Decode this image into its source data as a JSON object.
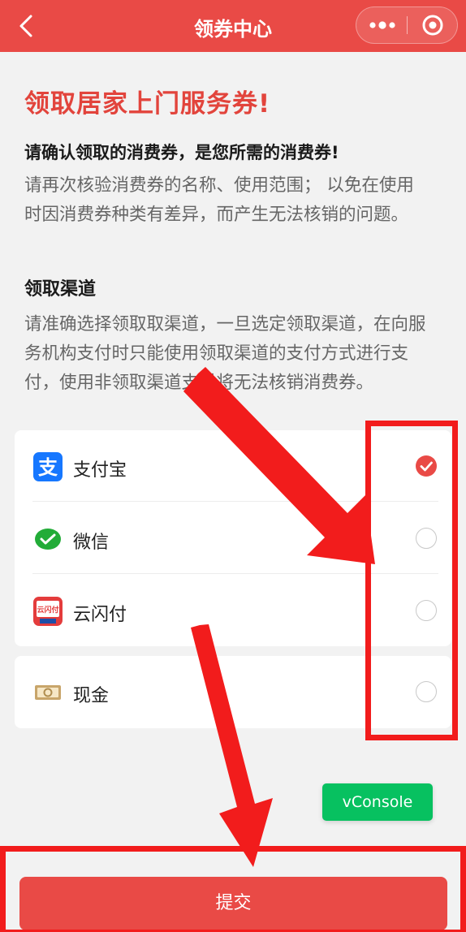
{
  "navbar": {
    "title": "领券中心",
    "back_icon": "chevron-left-icon",
    "more_icon": "more-dots-icon",
    "close_icon": "target-circle-icon",
    "color": "#e94a46"
  },
  "intro": {
    "headline": "领取居家上门服务券!",
    "confirm_title": "请确认领取的消费券，是您所需的消费券!",
    "confirm_text": "请再次核验消费券的名称、使用范围； 以免在使用时因消费券种类有差异，而产生无法核销的问题。",
    "channel_title": "领取渠道",
    "channel_text": "请准确选择领取取渠道，一旦选定领取渠道，在向服务机构支付时只能使用领取渠道的支付方式进行支付，使用非领取渠道支付将无法核销消费券。"
  },
  "channels": [
    {
      "label": "支付宝",
      "icon": "alipay-icon",
      "selected": true
    },
    {
      "label": "微信",
      "icon": "wechat-pay-icon",
      "selected": false
    },
    {
      "label": "云闪付",
      "icon": "unionpay-quickpass-icon",
      "selected": false
    }
  ],
  "cash": {
    "label": "现金",
    "icon": "cash-bill-icon",
    "selected": false
  },
  "vconsole": {
    "label": "vConsole",
    "color": "#07c160"
  },
  "footer": {
    "submit_label": "提交"
  },
  "colors": {
    "accent": "#e94a46",
    "annotation": "#f21c1c",
    "text_muted": "#666666"
  }
}
